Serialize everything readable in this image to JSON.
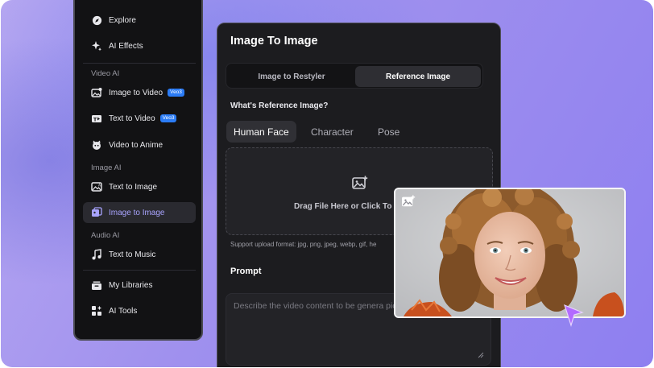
{
  "sidebar": {
    "explore": "Explore",
    "ai_effects": "AI Effects",
    "section_video": "Video AI",
    "image_to_video": "Image to Video",
    "text_to_video": "Text to Video",
    "video_badge": "Veo3",
    "video_to_anime": "Video to Anime",
    "section_image": "Image AI",
    "text_to_image": "Text to Image",
    "image_to_image": "Image to Image",
    "section_audio": "Audio AI",
    "text_to_music": "Text to Music",
    "my_libraries": "My Libraries",
    "ai_tools": "AI Tools"
  },
  "panel": {
    "title": "Image To Image",
    "tab_restyler": "Image to Restyler",
    "tab_reference": "Reference Image",
    "question": "What's Reference Image?",
    "ref_tabs": [
      "Human Face",
      "Character",
      "Pose"
    ],
    "upload_text": "Drag File Here or Click To",
    "support_text": "Support upload format: jpg, png, jpeg, webp, gif, he",
    "prompt_label": "Prompt",
    "prompt_placeholder": "Describe the video content to be genera picture"
  },
  "colors": {
    "accent": "#a9a4ff",
    "badge": "#2b7cf6",
    "cursor": "#b36bff"
  },
  "icons": [
    "explore-icon",
    "sparkle-icon",
    "image-video-icon",
    "text-video-icon",
    "anime-icon",
    "text-image-icon",
    "image-image-icon",
    "music-icon",
    "library-icon",
    "tools-icon",
    "image-add-icon",
    "pointer-cursor-icon"
  ]
}
